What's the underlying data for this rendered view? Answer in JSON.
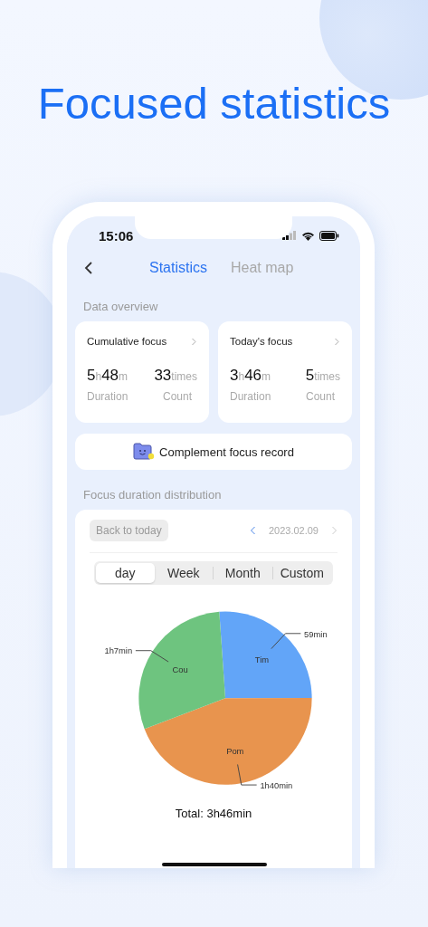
{
  "headline": "Focused statistics",
  "status_bar": {
    "time": "15:06"
  },
  "nav": {
    "tabs": [
      {
        "label": "Statistics",
        "selected": true
      },
      {
        "label": "Heat map",
        "selected": false
      }
    ]
  },
  "overview": {
    "title": "Data overview",
    "cards": [
      {
        "title": "Cumulative focus",
        "hours": "5",
        "hours_unit": "h",
        "minutes": "48",
        "minutes_unit": "m",
        "count": "33",
        "count_unit": "times",
        "duration_label": "Duration",
        "count_label": "Count"
      },
      {
        "title": "Today's focus",
        "hours": "3",
        "hours_unit": "h",
        "minutes": "46",
        "minutes_unit": "m",
        "count": "5",
        "count_unit": "times",
        "duration_label": "Duration",
        "count_label": "Count"
      }
    ]
  },
  "complement_button": {
    "label": "Complement focus record"
  },
  "distribution": {
    "title": "Focus duration distribution",
    "back_button": "Back to today",
    "date": "2023.02.09",
    "periods": [
      {
        "label": "day",
        "selected": true
      },
      {
        "label": "Week",
        "selected": false
      },
      {
        "label": "Month",
        "selected": false
      },
      {
        "label": "Custom",
        "selected": false
      }
    ],
    "chart_data": {
      "type": "pie",
      "categories": [
        "Tim",
        "Pom",
        "Cou"
      ],
      "values": [
        26.1,
        44.2,
        29.7
      ],
      "colors": [
        "#62a5f8",
        "#e8944e",
        "#6ec47f"
      ],
      "annotations": [
        {
          "text": "59min"
        },
        {
          "text": "1h40min"
        },
        {
          "text": "1h7min"
        }
      ]
    },
    "total": "Total: 3h46min"
  }
}
